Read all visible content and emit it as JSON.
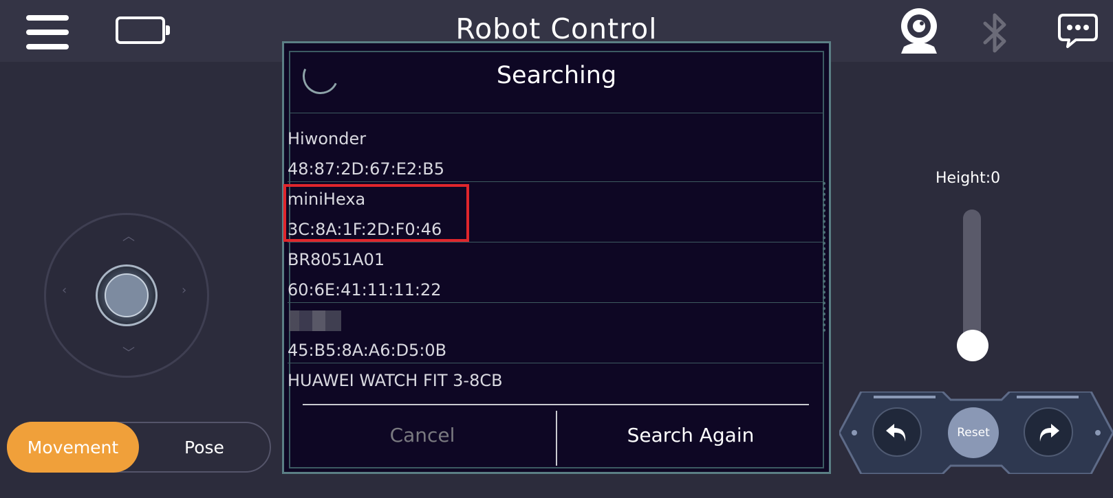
{
  "header": {
    "title": "Robot Control",
    "icons": [
      "menu-icon",
      "battery-icon",
      "camera-icon",
      "bluetooth-icon",
      "chat-icon"
    ]
  },
  "modes": {
    "movement_label": "Movement",
    "pose_label": "Pose",
    "active": "Movement",
    "active_color": "#f0a03a"
  },
  "height": {
    "label": "Height:0",
    "value": 0
  },
  "actions": {
    "reset_label": "Reset"
  },
  "dialog": {
    "title": "Searching",
    "devices": [
      {
        "name": "Hiwonder",
        "mac": "48:87:2D:67:E2:B5"
      },
      {
        "name": "miniHexa",
        "mac": "3C:8A:1F:2D:F0:46",
        "highlighted": true
      },
      {
        "name": "BR8051A01",
        "mac": "60:6E:41:11:11:22"
      },
      {
        "name": "",
        "mac": "45:B5:8A:A6:D5:0B",
        "name_redacted": true
      },
      {
        "name": "HUAWEI WATCH FIT 3-8CB",
        "mac": ""
      }
    ],
    "cancel_label": "Cancel",
    "search_again_label": "Search Again",
    "highlight_color": "#e0262c"
  }
}
